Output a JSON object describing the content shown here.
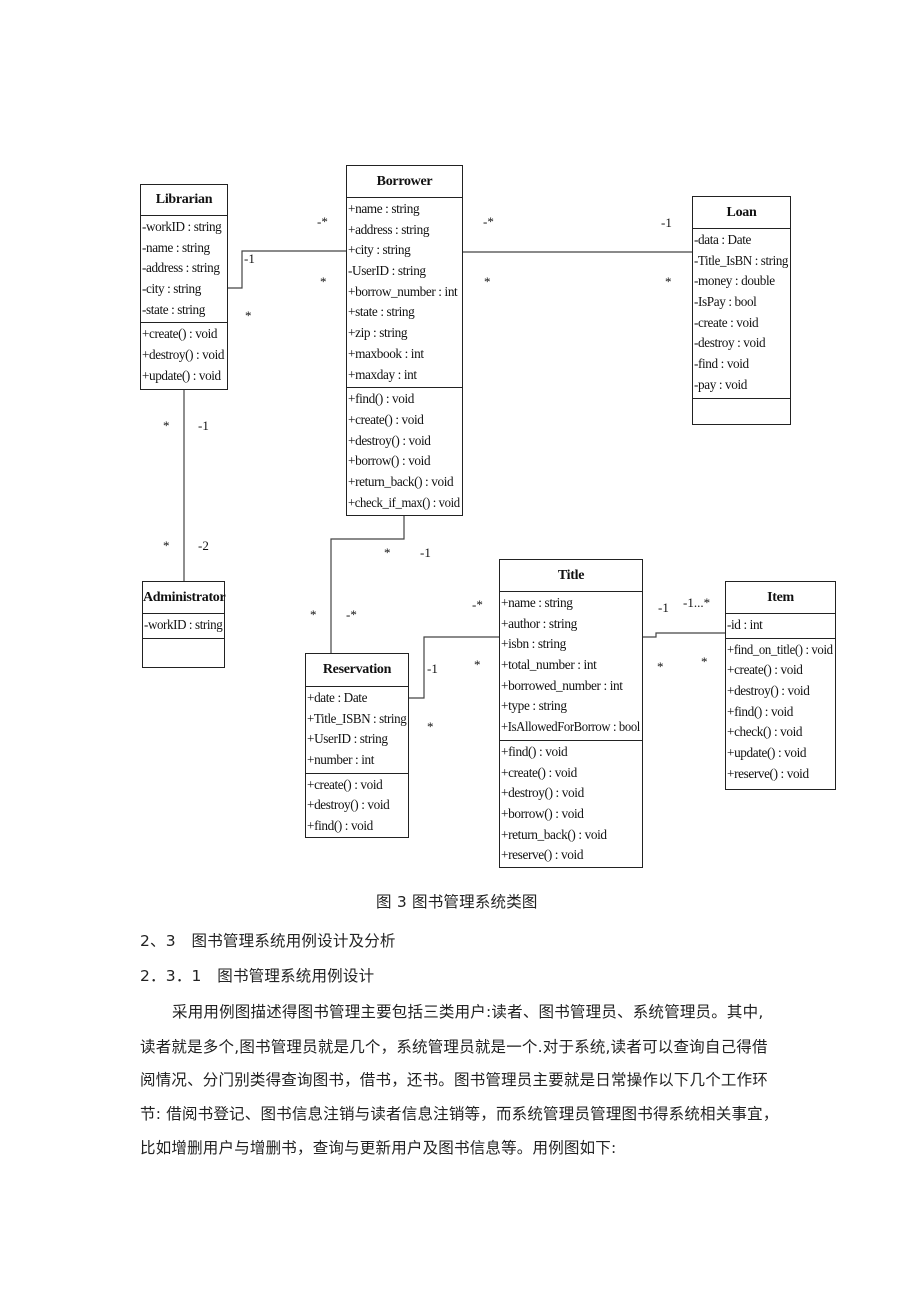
{
  "diagram": {
    "classes": {
      "librarian": {
        "name": "Librarian",
        "attributes": [
          "-workID : string",
          "-name : string",
          "-address : string",
          "-city : string",
          "-state : string"
        ],
        "methods": [
          "+create() : void",
          "+destroy() : void",
          "+update() : void"
        ]
      },
      "borrower": {
        "name": "Borrower",
        "attributes": [
          "+name : string",
          "+address : string",
          "+city : string",
          "-UserID : string",
          "+borrow_number : int",
          "+state : string",
          "+zip : string",
          "+maxbook : int",
          "+maxday : int"
        ],
        "methods": [
          "+find() : void",
          "+create() : void",
          "+destroy() : void",
          "+borrow() : void",
          "+return_back() : void",
          "+check_if_max() : void"
        ]
      },
      "loan": {
        "name": "Loan",
        "attributes": [
          "-data : Date",
          "-Title_IsBN : string",
          "-money : double",
          "-IsPay : bool",
          "-create : void",
          "-destroy : void",
          "-find : void",
          "-pay : void"
        ],
        "methods": []
      },
      "administrator": {
        "name": "Administrator",
        "attributes": [
          "-workID : string"
        ],
        "methods": []
      },
      "reservation": {
        "name": "Reservation",
        "attributes": [
          "+date : Date",
          "+Title_ISBN : string",
          "+UserID : string",
          "+number : int"
        ],
        "methods": [
          "+create() : void",
          "+destroy() : void",
          "+find() : void"
        ]
      },
      "title": {
        "name": "Title",
        "attributes": [
          "+name : string",
          "+author : string",
          "+isbn : string",
          "+total_number : int",
          "+borrowed_number : int",
          "+type : string",
          "+IsAllowedForBorrow : bool"
        ],
        "methods": [
          "+find() : void",
          "+create() : void",
          "+destroy() : void",
          "+borrow() : void",
          "+return_back() : void",
          "+reserve() : void"
        ]
      },
      "item": {
        "name": "Item",
        "attributes": [
          "-id : int"
        ],
        "methods": [
          "+find_on_title() : void",
          "+create() : void",
          "+destroy() : void",
          "+find() : void",
          "+check() : void",
          "+update() : void",
          "+reserve() : void"
        ]
      }
    },
    "multiplicities": {
      "lib_bor_1": "-*",
      "lib_bor_2": "-1",
      "lib_bor_3": "*",
      "lib_bor_4": "*",
      "bor_loan_1": "-*",
      "bor_loan_2": "-1",
      "bor_loan_3": "*",
      "bor_loan_4": "*",
      "lib_adm_1": "*",
      "lib_adm_2": "-1",
      "lib_adm_3": "*",
      "lib_adm_4": "-2",
      "bor_res_1": "*",
      "bor_res_2": "-1",
      "bor_res_3": "*",
      "bor_res_4": "-*",
      "res_tit_1": "-*",
      "res_tit_2": "-1",
      "res_tit_3": "*",
      "res_tit_4": "*",
      "tit_item_1": "-1",
      "tit_item_2": "-1...*",
      "tit_item_3": "*",
      "tit_item_4": "*"
    }
  },
  "caption": "图 3 图书管理系统类图",
  "headings": {
    "h2": "2、3　图书管理系统用例设计及分析",
    "h3": "2．3．1　图书管理系统用例设计"
  },
  "paragraph_lines": [
    "采用用例图描述得图书管理主要包括三类用户:读者、图书管理员、系统管理员。其中,",
    "读者就是多个,图书管理员就是几个，系统管理员就是一个.对于系统,读者可以查询自己得借",
    "阅情况、分门别类得查询图书，借书，还书。图书管理员主要就是日常操作以下几个工作环",
    "节: 借阅书登记、图书信息注销与读者信息注销等，而系统管理员管理图书得系统相关事宜，",
    "比如增删用户与增删书，查询与更新用户及图书信息等。用例图如下:"
  ]
}
